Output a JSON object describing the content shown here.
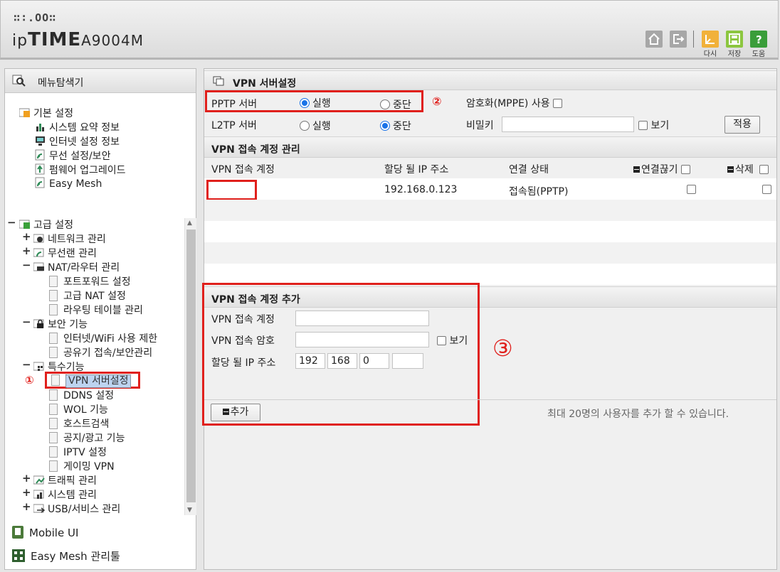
{
  "header": {
    "brand_top": "∷∶.OO∷",
    "brand_prefix": "ip",
    "brand_bold": "TIME",
    "brand_model": "A9004M",
    "buttons": [
      {
        "icon": "home-icon"
      },
      {
        "icon": "logout-icon"
      },
      {
        "icon": "restart-icon",
        "label": "다시"
      },
      {
        "icon": "save-icon",
        "label": "저장"
      },
      {
        "icon": "help-icon",
        "label": "도움"
      }
    ]
  },
  "sidebar": {
    "title": "메뉴탐색기",
    "basic": {
      "label": "기본 설정",
      "items": [
        "시스템 요약 정보",
        "인터넷 설정 정보",
        "무선 설정/보안",
        "펌웨어 업그레이드",
        "Easy Mesh"
      ]
    },
    "advanced": {
      "label": "고급 설정",
      "network": "네트워크 관리",
      "wireless": "무선랜 관리",
      "nat": {
        "label": "NAT/라우터 관리",
        "items": [
          "포트포워드 설정",
          "고급 NAT 설정",
          "라우팅 테이블 관리"
        ]
      },
      "security": {
        "label": "보안 기능",
        "items": [
          "인터넷/WiFi 사용 제한",
          "공유기 접속/보안관리"
        ]
      },
      "special": {
        "label": "특수기능",
        "items": [
          "VPN 서버설정",
          "DDNS 설정",
          "WOL 기능",
          "호스트검색",
          "공지/광고 기능",
          "IPTV 설정",
          "게이밍 VPN"
        ]
      },
      "traffic": "트래픽 관리",
      "system": "시스템 관리",
      "usb": "USB/서비스 관리"
    },
    "footer": [
      "Mobile UI",
      "Easy Mesh 관리툴"
    ],
    "marker": "①"
  },
  "main": {
    "title": "VPN 서버설정",
    "pptp": {
      "label": "PPTP 서버",
      "on": "실행",
      "off": "중단",
      "selected": "실행",
      "marker": "②"
    },
    "mppe": {
      "label": "암호화(MPPE) 사용",
      "checked": false
    },
    "l2tp": {
      "label": "L2TP 서버",
      "on": "실행",
      "off": "중단",
      "selected": "중단"
    },
    "secret": {
      "label": "비밀키",
      "value": "",
      "show_label": "보기"
    },
    "apply_label": "적용",
    "accounts": {
      "title": "VPN 접속 계정 관리",
      "headers": [
        "VPN 접속 계정",
        "할당 될 IP 주소",
        "연결 상태",
        "연결끊기",
        "삭제"
      ],
      "rows": [
        {
          "account": "",
          "ip": "192.168.0.123",
          "status": "접속됨(PPTP)"
        }
      ]
    },
    "add": {
      "title": "VPN 접속 계정 추가",
      "account_label": "VPN 접속 계정",
      "account_value": "",
      "password_label": "VPN 접속 암호",
      "password_value": "",
      "show_label": "보기",
      "ip_label": "할당 될 IP 주소",
      "ip": [
        "192",
        "168",
        "0",
        ""
      ],
      "add_button": "추가",
      "note": "최대 20명의 사용자를 추가 할 수 있습니다.",
      "marker": "③"
    }
  },
  "colors": {
    "highlight": "#e0201c",
    "accent": "#1a73e8"
  }
}
